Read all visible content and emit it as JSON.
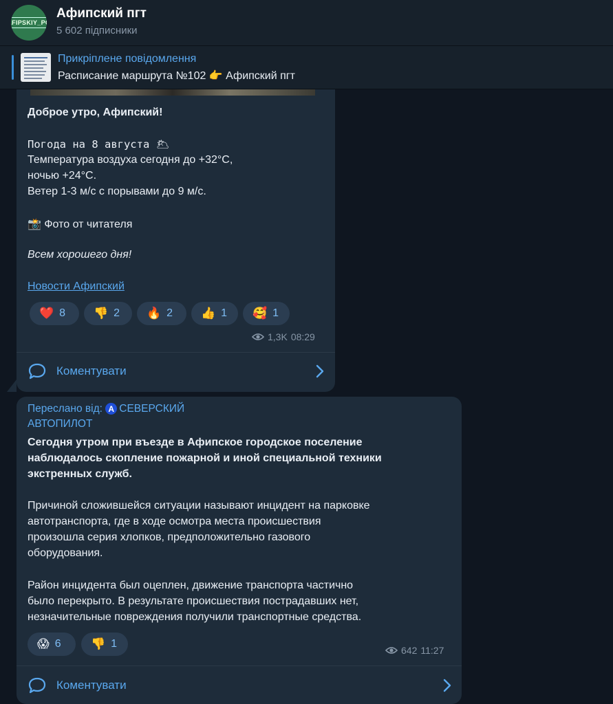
{
  "channel": {
    "avatar_text": "#AFIPSKIY_PGT",
    "title": "Афипский пгт",
    "subscribers": "5 602 підписники"
  },
  "pinned": {
    "label": "Прикріплене повідомлення",
    "text": "Расписание маршрута №102 👉 Афипский пгт"
  },
  "post1": {
    "greeting": "Доброе утро, Афипский!",
    "weather_line": "Погода на 8 августа 🌥",
    "temp_line1": "Температура воздуха сегодня до +32°C,",
    "temp_line2": "ночью +24°C.",
    "wind_line": "Ветер 1-3 м/с с порывами до 9 м/с.",
    "photo_line": "📸 Фото от читателя",
    "wish": "Всем хорошего дня!",
    "link": "Новости Афипский",
    "reactions": [
      {
        "emoji": "❤️",
        "count": "8"
      },
      {
        "emoji": "👎",
        "count": "2"
      },
      {
        "emoji": "🔥",
        "count": "2"
      },
      {
        "emoji": "👍",
        "count": "1"
      },
      {
        "emoji": "🥰",
        "count": "1"
      }
    ],
    "views": "1,3K",
    "time": "08:29",
    "comment_label": "Коментувати"
  },
  "post2": {
    "forward_label": "Переслано від:",
    "forward_badge": "A",
    "forward_source_line1": "СЕВЕРСКИЙ",
    "forward_source_line2": "АВТОПИЛОТ",
    "headline": [
      "Сегодня утром при въезде в Афипское городское поселение",
      "наблюдалось скопление пожарной и иной специальной техники",
      "экстренных служб."
    ],
    "para1": [
      "Причиной сложившейся ситуации называют инцидент на парковке",
      "автотранспорта, где в ходе осмотра места происшествия",
      "произошла серия хлопков, предположительно газового",
      "оборудования."
    ],
    "para2": [
      "Район инцидента был оцеплен, движение транспорта частично",
      "было перекрыто. В результате происшествия пострадавших нет,",
      "незначительные повреждения получили транспортные средства."
    ],
    "reactions": [
      {
        "emoji": "😱",
        "count": "6"
      },
      {
        "emoji": "👎",
        "count": "1"
      }
    ],
    "views": "642",
    "time": "11:27",
    "comment_label": "Коментувати"
  },
  "colors": {
    "background": "#0f1620",
    "bubble": "#1e2c3a",
    "accent": "#5aa8ee"
  }
}
